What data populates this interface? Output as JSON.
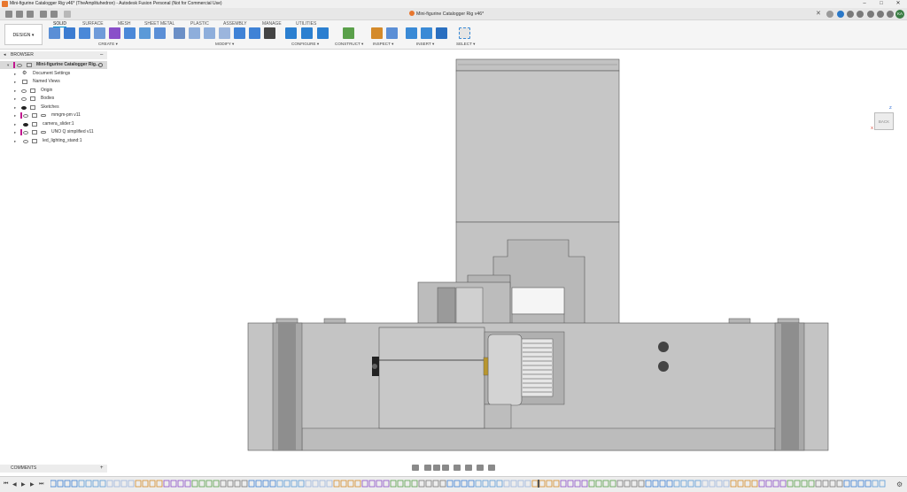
{
  "window": {
    "title": "Mini-figurine Catalogger Rig v46* (TheAmplituhedron) - Autodesk Fusion Personal (Not for Commercial Use)",
    "minimize": "–",
    "maximize": "□",
    "close": "✕"
  },
  "document_tab": {
    "title": "Mini-figurine Catalogger Rig v46*",
    "close": "✕"
  },
  "user": {
    "initials": "KA"
  },
  "workspace": {
    "label": "DESIGN ▾"
  },
  "ribbon": {
    "tabs": [
      "SOLID",
      "SURFACE",
      "MESH",
      "SHEET METAL",
      "PLASTIC",
      "ASSEMBLY",
      "MANAGE",
      "UTILITIES"
    ],
    "active_tab": "SOLID",
    "groups": [
      {
        "label": "CREATE ▾"
      },
      {
        "label": "MODIFY ▾"
      },
      {
        "label": "CONFIGURE ▾"
      },
      {
        "label": "CONSTRUCT ▾"
      },
      {
        "label": "INSPECT ▾"
      },
      {
        "label": "INSERT ▾"
      },
      {
        "label": "SELECT ▾"
      }
    ]
  },
  "browser": {
    "header": "BROWSER",
    "root": "Mini-figurine Catalogger Rig...",
    "items": [
      {
        "label": "Document Settings"
      },
      {
        "label": "Named Views"
      },
      {
        "label": "Origin"
      },
      {
        "label": "Bodies"
      },
      {
        "label": "Sketches"
      },
      {
        "label": "mmgm-pm v11"
      },
      {
        "label": "camera_slider:1"
      },
      {
        "label": "UNO Q simplified v11"
      },
      {
        "label": "led_lighting_stand:1"
      }
    ]
  },
  "viewcube": {
    "face": "BACK",
    "axis_z": "Z",
    "axis_x": "X"
  },
  "comments": {
    "header": "COMMENTS",
    "add": "+"
  },
  "colors": {
    "accent": "#0696d7",
    "model_light": "#c8c8c8",
    "model_mid": "#b3b3b3",
    "model_dark": "#8e8e8e",
    "edge": "#555555",
    "component_marker": "#c2178f"
  }
}
